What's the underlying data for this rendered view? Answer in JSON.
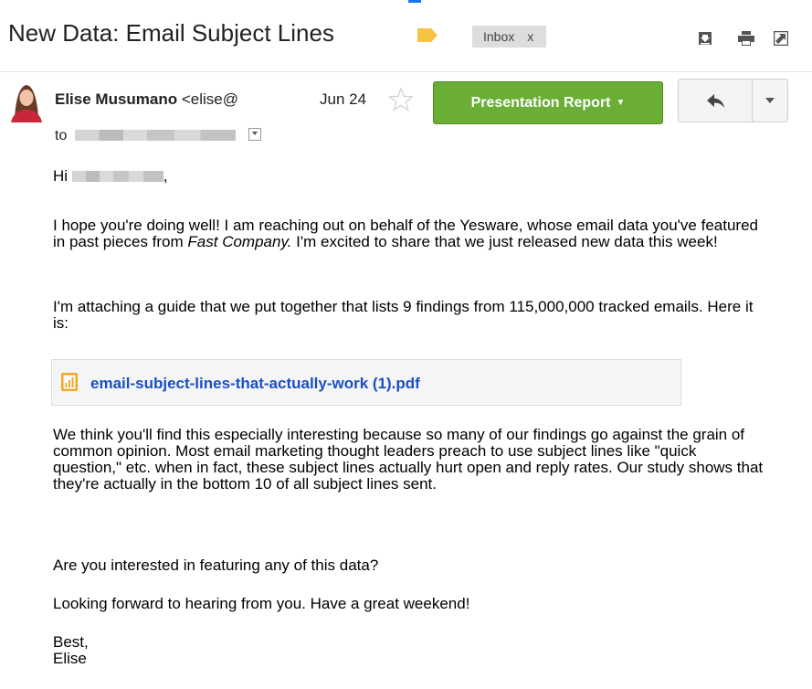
{
  "subject": {
    "title": "New Data: Email Subject Lines",
    "label_chip": "Inbox",
    "chip_close": "x"
  },
  "message": {
    "sender_name": "Elise Musumano",
    "sender_email": "<elise@",
    "date": "Jun 24",
    "to_prefix": "to",
    "action_button": "Presentation Report"
  },
  "body": {
    "greeting": "Hi",
    "greeting_suffix": ",",
    "p1_part1": "I hope you're doing well! I am reaching out on behalf of the Yesware, whose email data you've featured in past pieces from ",
    "p1_italic": "Fast Company.",
    "p1_part2": " I'm excited to share that we just released new data this week!",
    "p2": "I'm attaching a guide that we put together that lists 9 findings from 115,000,000 tracked emails. Here it is:",
    "attachment": "email-subject-lines-that-actually-work (1).pdf",
    "p3": "We think you'll find this especially interesting because so many of our findings go against the grain of common opinion. Most email marketing thought leaders preach to use subject lines like \"quick question,\" etc. when in fact, these subject lines actually hurt open and reply rates. Our study shows that they're actually in the bottom 10 of all subject lines sent.",
    "p4": "Are you interested in featuring any of this data?",
    "p5": "Looking forward to hearing from you. Have a great weekend!",
    "signoff": "Best,",
    "signature": "Elise"
  },
  "icons": {
    "label": "label-tag-icon",
    "download": "download-icon",
    "print": "print-icon",
    "popout": "open-in-new-window-icon",
    "star": "star-icon",
    "reply": "reply-icon",
    "more": "more-caret-icon",
    "recipient_details": "recipient-details-caret-icon",
    "attachment": "pdf-attachment-icon"
  },
  "colors": {
    "primary_button": "#6aae36",
    "label_tag": "#f6c344",
    "link": "#1a4fc4"
  }
}
